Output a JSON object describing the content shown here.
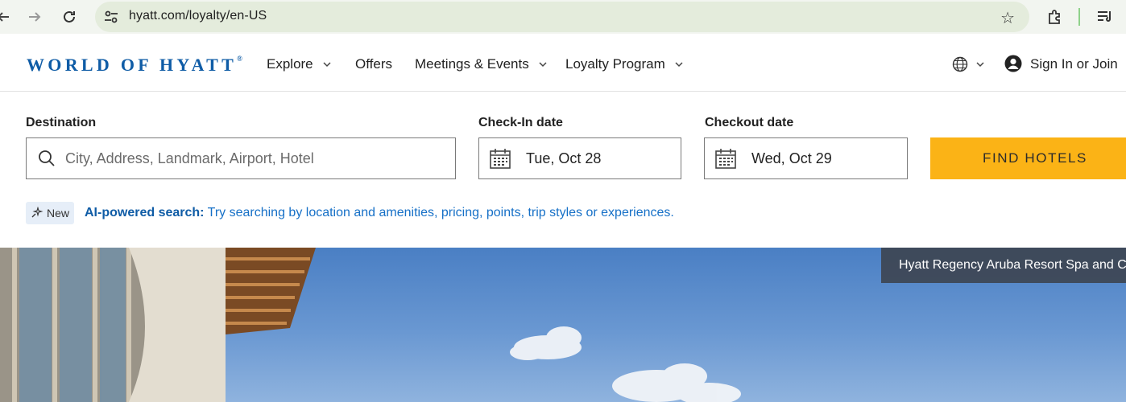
{
  "browser": {
    "url": "hyatt.com/loyalty/en-US",
    "icons": [
      "back-arrow-icon",
      "forward-arrow-icon",
      "reload-icon",
      "site-settings-icon",
      "bookmark-star-icon",
      "extensions-puzzle-icon",
      "media-controls-icon"
    ]
  },
  "header": {
    "logo_text": "WORLD OF HYATT",
    "logo_mark": "®",
    "nav": [
      {
        "label": "Explore",
        "has_dropdown": true
      },
      {
        "label": "Offers",
        "has_dropdown": false
      },
      {
        "label": "Meetings & Events",
        "has_dropdown": true
      },
      {
        "label": "Loyalty Program",
        "has_dropdown": true
      }
    ],
    "sign_in_label": "Sign In or Join"
  },
  "search": {
    "destination_label": "Destination",
    "destination_placeholder": "City, Address, Landmark, Airport, Hotel",
    "checkin_label": "Check-In date",
    "checkin_value": "Tue, Oct 28",
    "checkout_label": "Checkout date",
    "checkout_value": "Wed, Oct 29",
    "find_button": "FIND HOTELS",
    "badge": "New",
    "ai_title": "AI-powered search:",
    "ai_text": " Try searching by location and amenities, pricing, points, trip styles or experiences."
  },
  "hero": {
    "location": "Hyatt Regency Aruba Resort Spa and Casino"
  },
  "colors": {
    "brand_blue": "#0f5ca6",
    "link_blue": "#1670c7",
    "cta_yellow": "#fbb316",
    "chip_bg": "#3c424c"
  }
}
